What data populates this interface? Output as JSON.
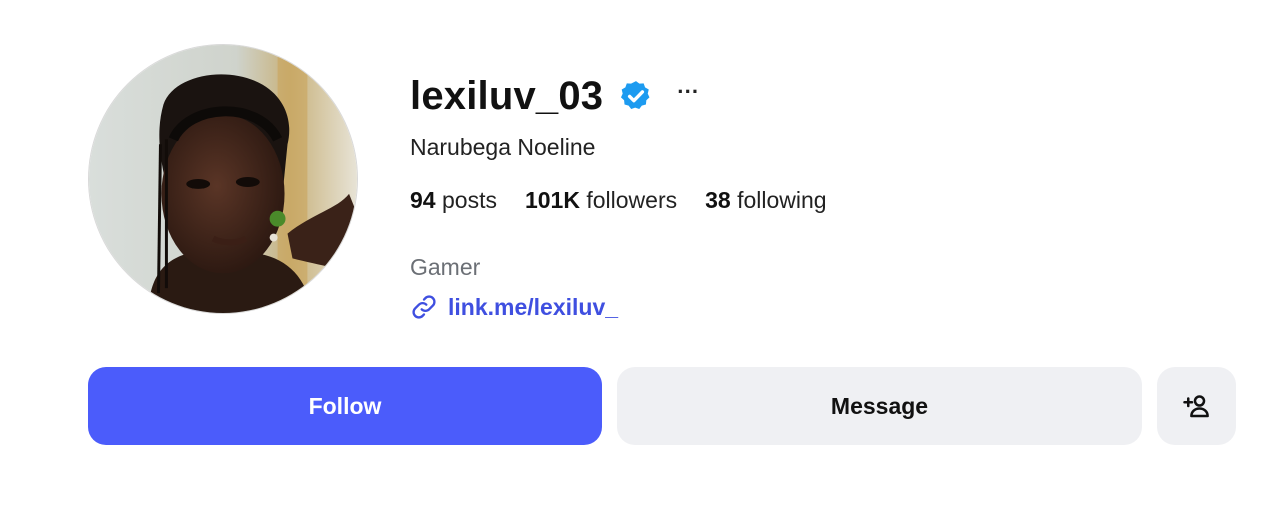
{
  "profile": {
    "username": "lexiluv_03",
    "verified": true,
    "more_label": "···",
    "full_name": "Narubega Noeline",
    "stats": {
      "posts_count": "94",
      "posts_label": "posts",
      "followers_count": "101K",
      "followers_label": "followers",
      "following_count": "38",
      "following_label": "following"
    },
    "bio": "Gamer",
    "link": "link.me/lexiluv_"
  },
  "actions": {
    "follow_label": "Follow",
    "message_label": "Message",
    "add_user_icon": "add-user-icon"
  },
  "colors": {
    "accent": "#4b5cfb",
    "link": "#3f4fe0",
    "verified": "#1d9bf0",
    "secondary_button": "#eff0f3",
    "muted_text": "#6b6f75"
  }
}
